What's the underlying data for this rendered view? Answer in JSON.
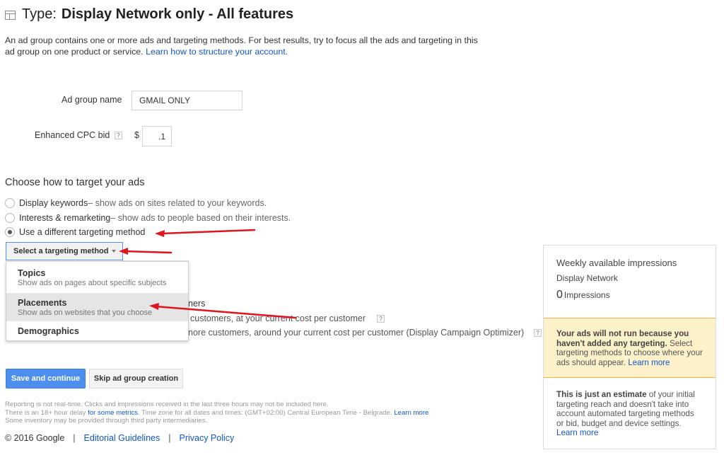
{
  "header": {
    "icon": "panel-icon",
    "title_prefix": "Type:",
    "title_main": "Display Network only - All features"
  },
  "intro": {
    "text": "An ad group contains one or more ads and targeting methods. For best results, try to focus all the ads and targeting in this ad group on one product or service. ",
    "link": "Learn how to structure your account."
  },
  "form": {
    "ad_group_name_label": "Ad group name",
    "ad_group_name_value": "GMAIL ONLY",
    "cpc_label": "Enhanced CPC bid",
    "help_glyph": "?",
    "currency": "$",
    "cpc_value": ".1"
  },
  "targeting": {
    "section_title": "Choose how to target your ads",
    "options": [
      {
        "label": "Display keywords",
        "desc": " – show ads on sites related to your keywords.",
        "checked": false
      },
      {
        "label": "Interests & remarketing",
        "desc": " – show ads to people based on their interests.",
        "checked": false
      },
      {
        "label": "Use a different targeting method",
        "desc": "",
        "checked": true
      }
    ],
    "select_label": "Select a targeting method",
    "menu": [
      {
        "title": "Topics",
        "desc": "Show ads on pages about specific subjects"
      },
      {
        "title": "Placements",
        "desc": "Show ads on websites that you choose"
      },
      {
        "title": "Demographics",
        "desc": ""
      }
    ]
  },
  "bid_options": {
    "line1": "ners",
    "line2": "customers, at your current cost per customer",
    "line3": "nore customers, around your current cost per customer (Display Campaign Optimizer)"
  },
  "side_panel": {
    "heading": "Weekly available impressions",
    "network": "Display Network",
    "count": "0",
    "count_unit": "Impressions",
    "warning_bold": "Your ads will not run because you haven't added any targeting.",
    "warning_text": " Select targeting methods to choose where your ads should appear. ",
    "warning_link": "Learn more",
    "note_bold": "This is just an estimate",
    "note_text": " of your initial targeting reach and doesn't take into account automated targeting methods or bid, budget and device settings.",
    "note_link": "Learn more"
  },
  "buttons": {
    "save": "Save and continue",
    "skip": "Skip ad group creation"
  },
  "fine_print": {
    "line1": "Reporting is not real-time. Clicks and impressions received in the last three hours may not be included here.",
    "line2_a": "There is an 18+ hour delay ",
    "line2_link": "for some metrics",
    "line2_b": ". Time zone for all dates and times: (GMT+02:00) Central European Time - Belgrade. ",
    "line2_link2": "Learn more",
    "line3": "Some inventory may be provided through third party intermediaries."
  },
  "footer": {
    "copyright": "© 2016 Google",
    "separator": "|",
    "links": [
      "Editorial Guidelines",
      "Privacy Policy"
    ]
  },
  "colors": {
    "link": "#1155cc",
    "primary_button": "#4d8fef",
    "warning_bg": "#fcf1c8",
    "warning_border": "#f5b24a",
    "annotation_arrow": "#e0141e"
  }
}
